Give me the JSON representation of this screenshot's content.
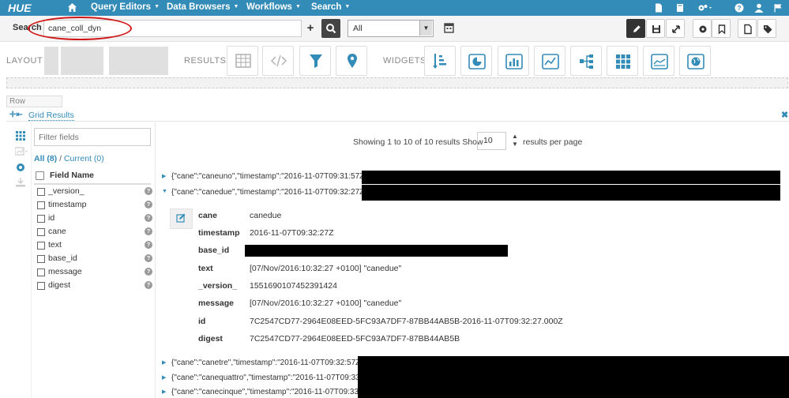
{
  "topnav": {
    "logo": "HUE",
    "menus": [
      "Query Editors",
      "Data Browsers",
      "Workflows",
      "Search"
    ]
  },
  "search": {
    "label": "Search",
    "collection_value": "cane_coll_dyn",
    "filter_select": "All"
  },
  "toolbar": {
    "layout_label": "LAYOUT",
    "results_label": "RESULTS",
    "widgets_label": "WIDGETS"
  },
  "row_label": "Row",
  "grid": {
    "title": "Grid Results"
  },
  "fields_panel": {
    "filter_placeholder": "Filter fields",
    "all_label": "All (8)",
    "separator": " / ",
    "current_label": "Current (0)",
    "header": "Field Name",
    "fields": [
      "_version_",
      "timestamp",
      "id",
      "cane",
      "text",
      "base_id",
      "message",
      "digest"
    ]
  },
  "pager": {
    "showing": "Showing 1 to 10 of 10 results Show",
    "per_page_value": "10",
    "suffix": "results per page"
  },
  "results": [
    {
      "text": "{\"cane\":\"caneuno\",\"timestamp\":\"2016-11-07T09:31:57Z\"",
      "expanded": false
    },
    {
      "text": "{\"cane\":\"canedue\",\"timestamp\":\"2016-11-07T09:32:27Z\"",
      "expanded": true
    },
    {
      "text": "{\"cane\":\"canetre\",\"timestamp\":\"2016-11-07T09:32:57Z",
      "expanded": false
    },
    {
      "text": "{\"cane\":\"canequattro\",\"timestamp\":\"2016-11-07T09:33",
      "expanded": false
    },
    {
      "text": "{\"cane\":\"canecinque\",\"timestamp\":\"2016-11-07T09:33",
      "expanded": false
    }
  ],
  "detail": [
    {
      "key": "cane",
      "value": "canedue"
    },
    {
      "key": "timestamp",
      "value": "2016-11-07T09:32:27Z"
    },
    {
      "key": "base_id",
      "value": ""
    },
    {
      "key": "text",
      "value": "[07/Nov/2016:10:32:27 +0100] \"canedue\""
    },
    {
      "key": "_version_",
      "value": "1551690107452391424"
    },
    {
      "key": "message",
      "value": "[07/Nov/2016:10:32:27 +0100] \"canedue\""
    },
    {
      "key": "id",
      "value": "7C2547CD77-2964E08EED-5FC93A7DF7-87BB44AB5B-2016-11-07T09:32:27.000Z"
    },
    {
      "key": "digest",
      "value": "7C2547CD77-2964E08EED-5FC93A7DF7-87BB44AB5B"
    }
  ],
  "colors": {
    "nav_blue": "#338bb8",
    "highlight_red": "#d01616",
    "accent_blue": "#338bb8"
  }
}
